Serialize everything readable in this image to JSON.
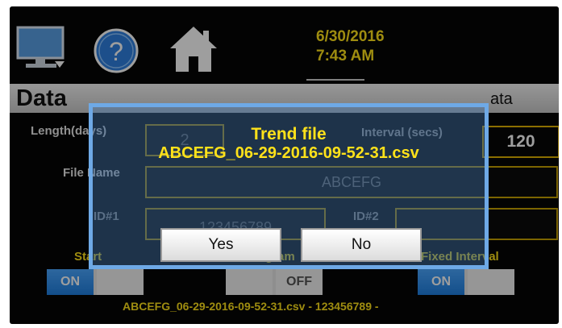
{
  "topbar": {
    "date": "6/30/2016",
    "time": "7:43 AM",
    "icons": [
      "monitor-icon",
      "help-icon",
      "home-icon"
    ]
  },
  "page": {
    "title": "Data",
    "title_right": "ata"
  },
  "form": {
    "length_label": "Length(days)",
    "length_value": "2",
    "interval_label": "Interval (secs)",
    "interval_value": "120",
    "file_name_label": "File Name",
    "file_name_value": "ABCEFG",
    "id1_label": "ID#1",
    "id1_value": "123456789",
    "id2_label": "ID#2",
    "id2_value": "",
    "start_label": "Start",
    "start_toggle_label": "ON",
    "program_label": "Program",
    "program_toggle_label": "OFF",
    "fixed_interval_label": "Fixed Interval",
    "fixed_interval_toggle_label": "ON"
  },
  "footer": {
    "status_text": "ABCEFG_06-29-2016-09-52-31.csv - 123456789 -"
  },
  "dialog": {
    "title": "Trend file",
    "filename": "ABCEFG_06-29-2016-09-52-31.csv",
    "yes_label": "Yes",
    "no_label": "No"
  },
  "colors": {
    "accent_yellow": "#ffe21a",
    "toggle_blue": "#2a8cf0",
    "dialog_border": "#6ea9e6"
  }
}
